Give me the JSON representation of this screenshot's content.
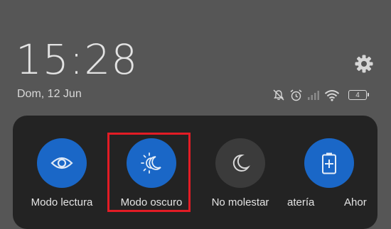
{
  "status": {
    "time": "15:28",
    "date": "Dom, 12 Jun",
    "battery_level": "4",
    "icons": [
      "mute-icon",
      "alarm-icon",
      "signal-icon",
      "wifi-icon",
      "battery-icon"
    ]
  },
  "header": {
    "settings_icon": "gear-icon"
  },
  "quick_settings": {
    "tiles": [
      {
        "label": "Modo lectura",
        "icon": "eye-icon",
        "active": true
      },
      {
        "label": "Modo oscuro",
        "icon": "dark-mode-icon",
        "active": true
      },
      {
        "label": "No molestar",
        "icon": "moon-icon",
        "active": false
      },
      {
        "label": "atería",
        "icon": "battery-saver-icon",
        "active": true
      },
      {
        "label": "Ahor",
        "icon": "",
        "active": true
      }
    ]
  },
  "colors": {
    "background": "#565656",
    "panel": "#232323",
    "tile_active": "#1a67c7",
    "tile_inactive": "#3b3b3b",
    "highlight": "#e31c25"
  }
}
